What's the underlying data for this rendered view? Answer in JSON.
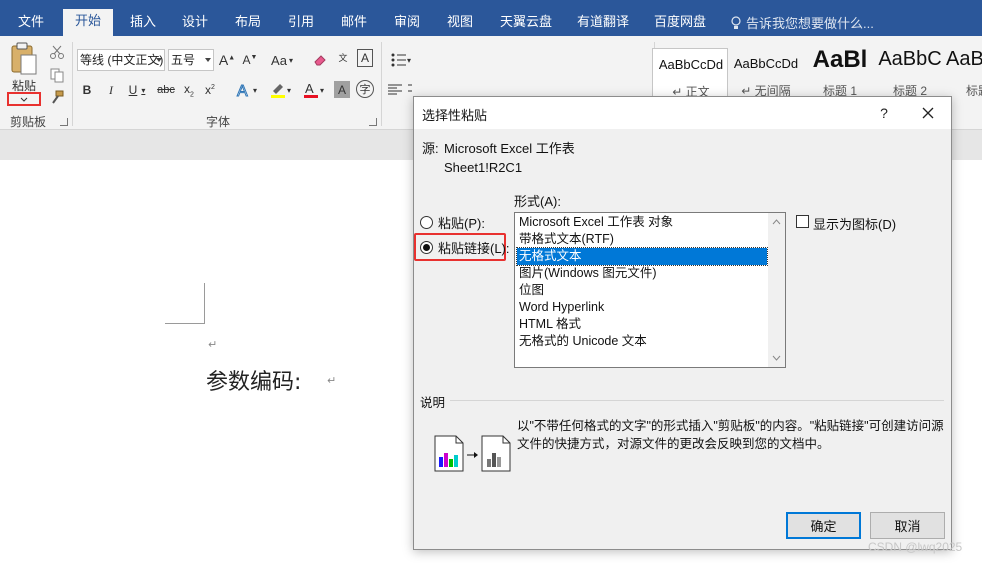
{
  "tabs": [
    {
      "label": "文件",
      "active": false
    },
    {
      "label": "开始",
      "active": true
    },
    {
      "label": "插入",
      "active": false
    },
    {
      "label": "设计",
      "active": false
    },
    {
      "label": "布局",
      "active": false
    },
    {
      "label": "引用",
      "active": false
    },
    {
      "label": "邮件",
      "active": false
    },
    {
      "label": "审阅",
      "active": false
    },
    {
      "label": "视图",
      "active": false
    },
    {
      "label": "天翼云盘",
      "active": false
    },
    {
      "label": "有道翻译",
      "active": false
    },
    {
      "label": "百度网盘",
      "active": false
    }
  ],
  "tell_me": "告诉我您想要做什么...",
  "ribbon": {
    "paste_label": "粘贴",
    "clipboard_group": "剪贴板",
    "font_group": "字体",
    "font_name": "等线 (中文正文)",
    "font_size": "五号",
    "change_case": "Aa",
    "styles": [
      {
        "sample": "AaBbCcDd",
        "name": "↵ 正文"
      },
      {
        "sample": "AaBbCcDd",
        "name": "↵ 无间隔"
      },
      {
        "sample": "AaBl",
        "name": "标题 1"
      },
      {
        "sample": "AaBbC",
        "name": "标题 2"
      },
      {
        "sample": "AaBb",
        "name": "标题"
      }
    ],
    "colors": {
      "highlight": "#ffff00",
      "font_color": "#e81123",
      "brand": "#2b579a"
    }
  },
  "document": {
    "text": "参数编码:"
  },
  "dialog": {
    "title": "选择性粘贴",
    "help": "?",
    "source_label": "源:",
    "source_value": "Microsoft Excel 工作表",
    "source_ref": "Sheet1!R2C1",
    "format_label": "形式(A):",
    "radio_paste": "粘贴(P):",
    "radio_paste_link": "粘贴链接(L):",
    "selected_radio": "paste_link",
    "formats": [
      "Microsoft Excel 工作表 对象",
      "带格式文本(RTF)",
      "无格式文本",
      "图片(Windows 图元文件)",
      "位图",
      "Word Hyperlink",
      "HTML 格式",
      "无格式的 Unicode 文本"
    ],
    "selected_format_index": 2,
    "display_as_icon": "显示为图标(D)",
    "display_as_icon_checked": false,
    "desc_label": "说明",
    "desc_text": "以\"不带任何格式的文字\"的形式插入\"剪贴板\"的内容。\"粘贴链接\"可创建访问源文件的快捷方式，对源文件的更改会反映到您的文档中。",
    "ok": "确定",
    "cancel": "取消"
  },
  "watermark": "CSDN @lwq2025"
}
